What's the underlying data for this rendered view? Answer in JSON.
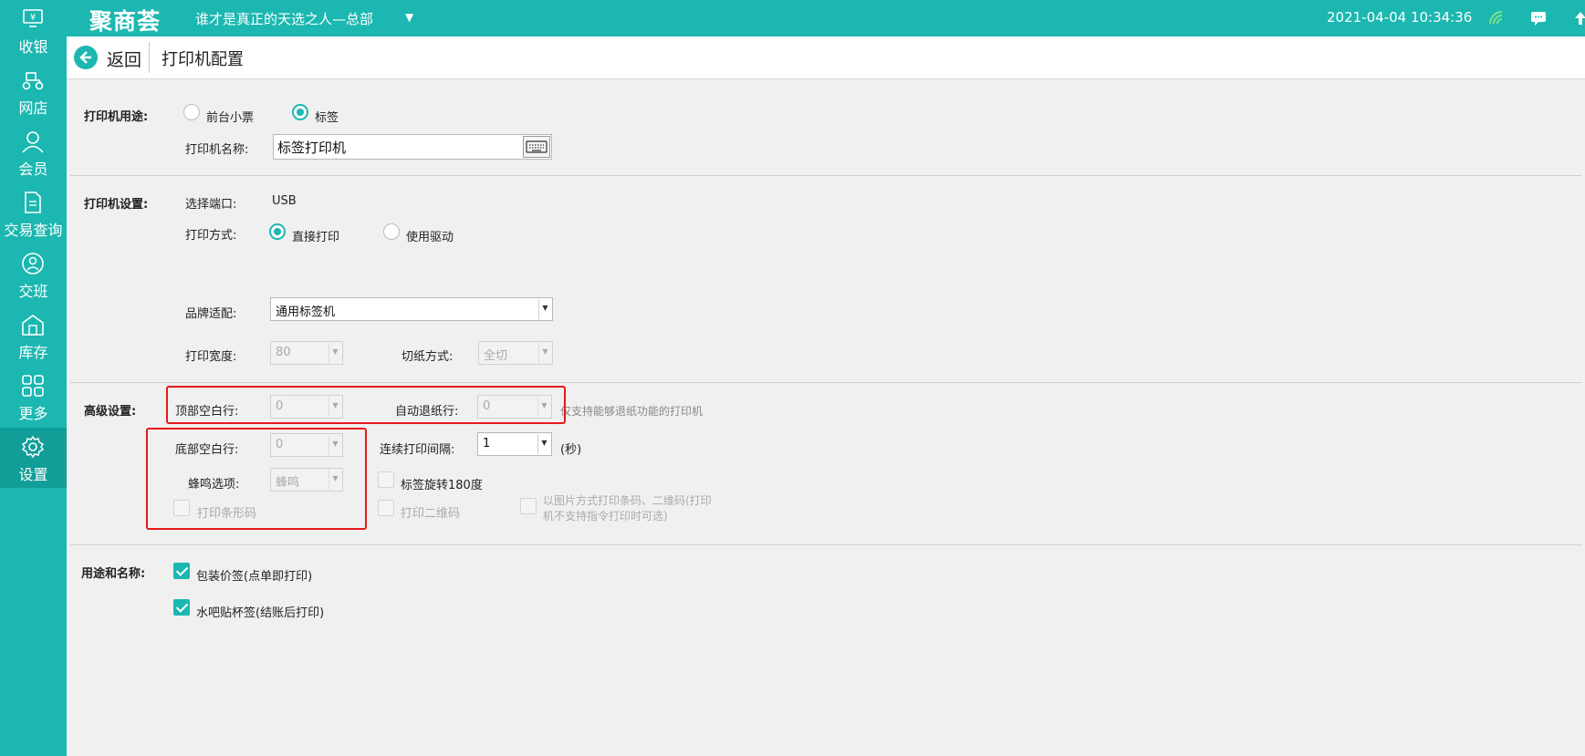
{
  "app": {
    "logo": "聚商荟",
    "store_name": "谁才是真正的天选之人—总部",
    "datetime": "2021-04-04 10:34:36",
    "accent_color": "#1bb7b0"
  },
  "sidebar": {
    "items": [
      {
        "label": "收银",
        "icon": "cash-register-icon"
      },
      {
        "label": "网店",
        "icon": "delivery-scooter-icon"
      },
      {
        "label": "会员",
        "icon": "user-icon"
      },
      {
        "label": "交易查询",
        "icon": "document-icon"
      },
      {
        "label": "交班",
        "icon": "handover-icon"
      },
      {
        "label": "库存",
        "icon": "warehouse-icon"
      },
      {
        "label": "更多",
        "icon": "grid-icon"
      },
      {
        "label": "设置",
        "icon": "gear-icon"
      }
    ],
    "active": "设置"
  },
  "header": {
    "back_label": "返回",
    "title": "打印机配置"
  },
  "purpose_section": {
    "title": "打印机用途:",
    "option_receipt": "前台小票",
    "option_label": "标签",
    "selected": "标签",
    "name_label": "打印机名称:",
    "name_value": "标签打印机"
  },
  "printer_settings": {
    "title": "打印机设置:",
    "port_label": "选择端口:",
    "port_value": "USB",
    "method_label": "打印方式:",
    "method_direct": "直接打印",
    "method_driver": "使用驱动",
    "method_selected": "直接打印",
    "brand_label": "品牌适配:",
    "brand_value": "通用标签机",
    "width_label": "打印宽度:",
    "width_value": "80",
    "cut_label": "切纸方式:",
    "cut_value": "全切"
  },
  "advanced": {
    "title": "高级设置:",
    "top_blank_label": "顶部空白行:",
    "top_blank_value": "0",
    "auto_retreat_label": "自动退纸行:",
    "auto_retreat_value": "0",
    "retreat_note": "仅支持能够退纸功能的打印机",
    "bottom_blank_label": "底部空白行:",
    "bottom_blank_value": "0",
    "interval_label": "连续打印间隔:",
    "interval_value": "1",
    "interval_unit": "(秒)",
    "beep_label": "蜂鸣选项:",
    "beep_value": "蜂鸣",
    "rotate_label": "标签旋转180度",
    "barcode_label": "打印条形码",
    "qrcode_label": "打印二维码",
    "image_mode_line1": "以图片方式打印条码、二维码(打印",
    "image_mode_line2": "机不支持指令打印时可选)"
  },
  "usage": {
    "title": "用途和名称:",
    "item1": "包装价签(点单即打印)",
    "item2": "水吧贴杯签(结账后打印)"
  }
}
